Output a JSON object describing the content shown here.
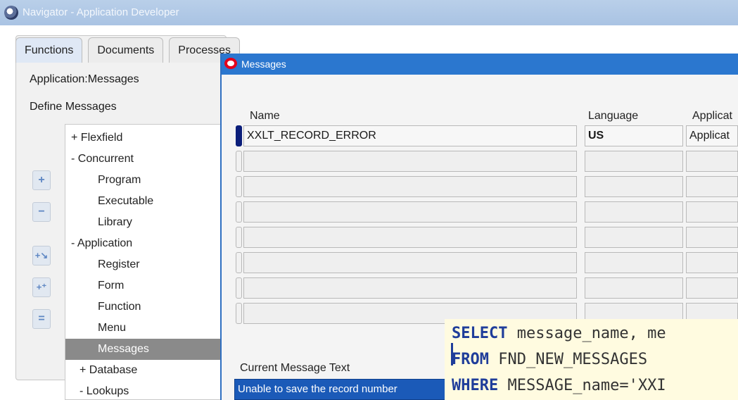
{
  "navigator": {
    "title": "Navigator - Application Developer",
    "tabs": [
      {
        "label": "Functions"
      },
      {
        "label": "Documents"
      },
      {
        "label": "Processes"
      }
    ],
    "application_label": "Application:Messages",
    "section_label": "Define Messages",
    "tree": [
      {
        "label": "+ Flexfield"
      },
      {
        "label": "- Concurrent"
      },
      {
        "label": "Program"
      },
      {
        "label": "Executable"
      },
      {
        "label": "Library"
      },
      {
        "label": "- Application"
      },
      {
        "label": "Register"
      },
      {
        "label": "Form"
      },
      {
        "label": "Function"
      },
      {
        "label": "Menu"
      },
      {
        "label": "Messages"
      },
      {
        "label": "+ Database"
      },
      {
        "label": "- Lookups"
      }
    ],
    "side_buttons": [
      {
        "icon": "expand-icon",
        "glyph": "+"
      },
      {
        "icon": "collapse-icon",
        "glyph": "−"
      },
      {
        "icon": "expand-branch-icon",
        "glyph": "+↘"
      },
      {
        "icon": "expand-all-icon",
        "glyph": "+⁺"
      },
      {
        "icon": "collapse-all-icon",
        "glyph": "="
      }
    ]
  },
  "messages_window": {
    "title": "Messages",
    "columns": {
      "name": "Name",
      "language": "Language",
      "application": "Applicat"
    },
    "rows": [
      {
        "name": "XXLT_RECORD_ERROR",
        "language": "US",
        "application": "Applicat"
      },
      {
        "name": "",
        "language": "",
        "application": ""
      },
      {
        "name": "",
        "language": "",
        "application": ""
      },
      {
        "name": "",
        "language": "",
        "application": ""
      },
      {
        "name": "",
        "language": "",
        "application": ""
      },
      {
        "name": "",
        "language": "",
        "application": ""
      },
      {
        "name": "",
        "language": "",
        "application": ""
      },
      {
        "name": "",
        "language": "",
        "application": ""
      }
    ],
    "current_message_label": "Current Message Text",
    "current_message_value": "Unable to save the record number"
  },
  "sql_overlay": {
    "line1": {
      "kw": "SELECT",
      "rest": " message_name, me"
    },
    "line2": {
      "kw": "FROM",
      "rest": " FND_NEW_MESSAGES"
    },
    "line3": {
      "kw": "WHERE",
      "rest": " MESSAGE_name='XXI"
    }
  },
  "colors": {
    "title_blue": "#2b77cf",
    "selected_tree": "#8a8a8a",
    "current_field": "#1b5ab8",
    "sql_keyword": "#1f3d9a",
    "sql_bg": "#fffbe0"
  }
}
